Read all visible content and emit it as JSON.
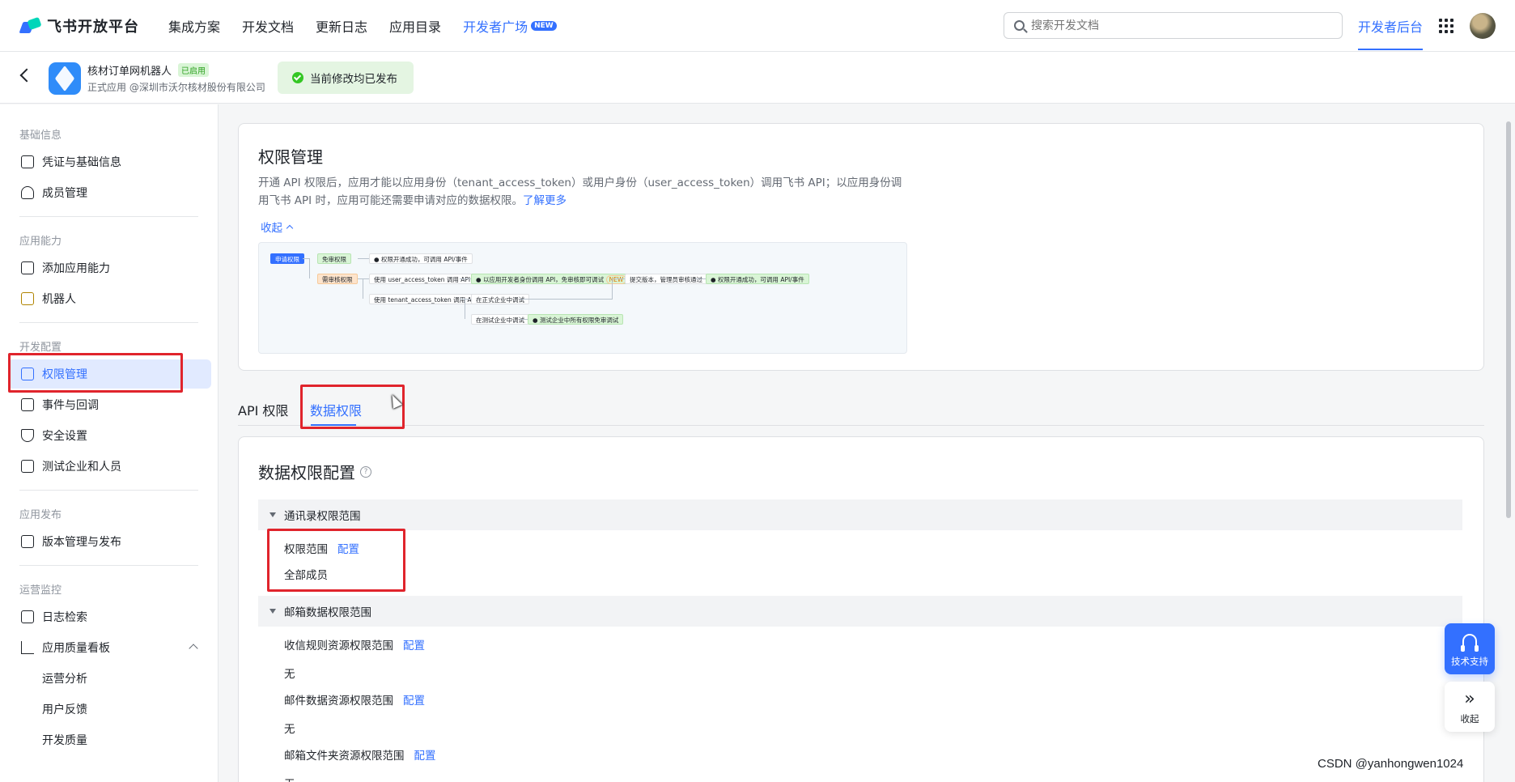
{
  "topnav": {
    "brand": "飞书开放平台",
    "links": [
      "集成方案",
      "开发文档",
      "更新日志",
      "应用目录",
      "开发者广场"
    ],
    "new_badge": "NEW",
    "search_placeholder": "搜索开发文档",
    "dev_console": "开发者后台"
  },
  "app": {
    "name": "核材订单网机器人",
    "status_badge": "已启用",
    "subtitle": "正式应用 @深圳市沃尔核材股份有限公司",
    "publish_status": "当前修改均已发布"
  },
  "sidebar": {
    "sections": [
      {
        "title": "基础信息",
        "items": [
          "凭证与基础信息",
          "成员管理"
        ]
      },
      {
        "title": "应用能力",
        "items": [
          "添加应用能力",
          "机器人"
        ]
      },
      {
        "title": "开发配置",
        "items": [
          "权限管理",
          "事件与回调",
          "安全设置",
          "测试企业和人员"
        ]
      },
      {
        "title": "应用发布",
        "items": [
          "版本管理与发布"
        ]
      },
      {
        "title": "运营监控",
        "items": [
          "日志检索",
          "应用质量看板"
        ],
        "subitems": [
          "运营分析",
          "用户反馈",
          "开发质量"
        ]
      }
    ]
  },
  "permission_card": {
    "title": "权限管理",
    "desc": "开通 API 权限后，应用才能以应用身份（tenant_access_token）或用户身份（user_access_token）调用飞书 API；以应用身份调用飞书 API 时，应用可能还需要申请对应的数据权限。",
    "learn_more": "了解更多",
    "collapse": "收起",
    "flow": {
      "apply": "申请权限",
      "no_review": "免审权限",
      "success1": "权限开通成功，可调用 API/事件",
      "need_review": "需审核权限",
      "user_token": "使用 user_access_token 调用 API",
      "dev_identity": "以应用开发者身份调用 API，免审核即可调试",
      "new": "NEW",
      "submit": "提交版本，管理员审核通过",
      "success2": "权限开通成功，可调用 API/事件",
      "tenant_token": "使用 tenant_access_token 调用 API/事件",
      "formal_debug": "在正式企业中调试",
      "test_debug": "在测试企业中调试",
      "test_members": "测试企业中所有权限免审调试"
    }
  },
  "tabs": [
    "API 权限",
    "数据权限"
  ],
  "data_perm": {
    "title": "数据权限配置",
    "groups": [
      {
        "title": "通讯录权限范围",
        "rows": [
          {
            "label": "权限范围",
            "action": "配置",
            "value": "全部成员"
          }
        ]
      },
      {
        "title": "邮箱数据权限范围",
        "rows": [
          {
            "label": "收信规则资源权限范围",
            "action": "配置",
            "value": "无"
          },
          {
            "label": "邮件数据资源权限范围",
            "action": "配置",
            "value": "无"
          },
          {
            "label": "邮箱文件夹资源权限范围",
            "action": "配置",
            "value": "无"
          }
        ]
      }
    ]
  },
  "float": {
    "support": "技术支持",
    "collapse": "收起"
  },
  "watermark": "CSDN @yanhongwen1024",
  "colors": {
    "accent": "#3370ff",
    "highlight_box": "#e0242c",
    "success": "#34c724"
  }
}
